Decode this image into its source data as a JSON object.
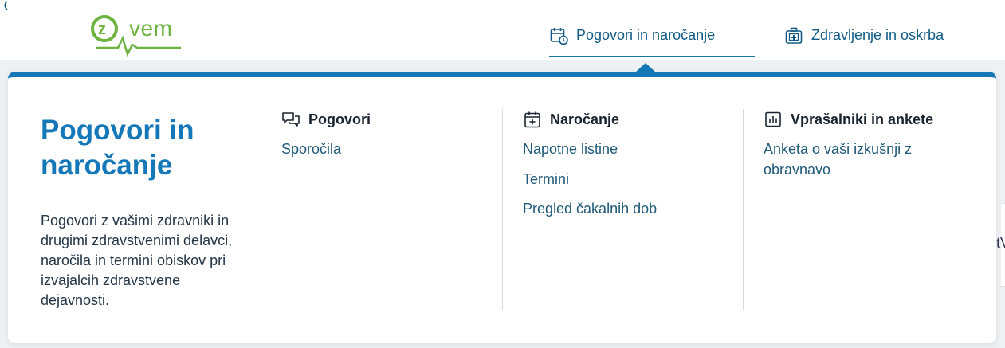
{
  "logo": {
    "text": "vem",
    "badge_letter": "z",
    "icon": "zvem-logo-icon",
    "color": "#6db33f"
  },
  "nav": {
    "items": [
      {
        "label": "Pogovori in naročanje",
        "icon": "calendar-clock-icon",
        "active": true
      },
      {
        "label": "Zdravljenje in oskrba",
        "icon": "medical-kit-icon",
        "active": false
      }
    ]
  },
  "menu": {
    "intro": {
      "title": "Pogovori in naročanje",
      "description": "Pogovori z vašimi zdravniki in drugimi zdravstvenimi delavci, naročila in termini obiskov pri izvajalcih zdravstvene dejavnosti."
    },
    "columns": [
      {
        "title": "Pogovori",
        "icon": "chat-bubbles-icon",
        "links": [
          "Sporočila"
        ]
      },
      {
        "title": "Naročanje",
        "icon": "calendar-plus-icon",
        "links": [
          "Napotne listine",
          "Termini",
          "Pregled čakalnih dob"
        ]
      },
      {
        "title": "Vprašalniki in ankete",
        "icon": "bar-chart-icon",
        "links": [
          "Anketa o vaši izkušnji z obravnavo"
        ]
      }
    ]
  },
  "background": {
    "peek_text": "tV"
  },
  "colors": {
    "accent": "#1478b8",
    "link": "#1f5a78",
    "brand_green": "#6db33f"
  }
}
